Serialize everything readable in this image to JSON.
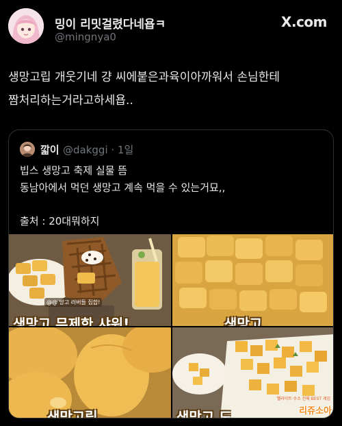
{
  "author": {
    "display_name": "밍이 리밋걸렸다네욥ㅋ",
    "handle": "@mingnya0"
  },
  "brand": "X.com",
  "tweet": {
    "lines": [
      "생망고립 개웃기네 걍 씨에붙은과육이아까워서 손님한테",
      "짬처리하는거라고하세욥.."
    ]
  },
  "quote": {
    "name": "깗이",
    "handle_time": "@dakggi · 1일",
    "lines": [
      "빕스 생망고 축제 실물 뜸",
      "동남아에서 먹던 생망고 계속 먹을 수 있는거묘,,"
    ],
    "source": "출처 : 20대뭐하지"
  },
  "media": {
    "tile1_caption": "생망고 무제한 샤워!",
    "tile1_sub": "@@ 망고 러버들 집합!",
    "tile2_caption": "생망고",
    "tile3_caption": "생망고립",
    "tile4_caption": "생망고 도",
    "watermark": "리쥬소아",
    "watermark_small": "웰라이트·수소 전체 BEST 게임"
  },
  "icons": {
    "avatar": "anime-girl-avatar",
    "quote_avatar": "profile-photo-avatar"
  },
  "colors": {
    "background": "#000000",
    "text": "#e7e9ea",
    "secondary": "#71767b",
    "border": "#2f3336",
    "mango": "#e8b04a"
  }
}
